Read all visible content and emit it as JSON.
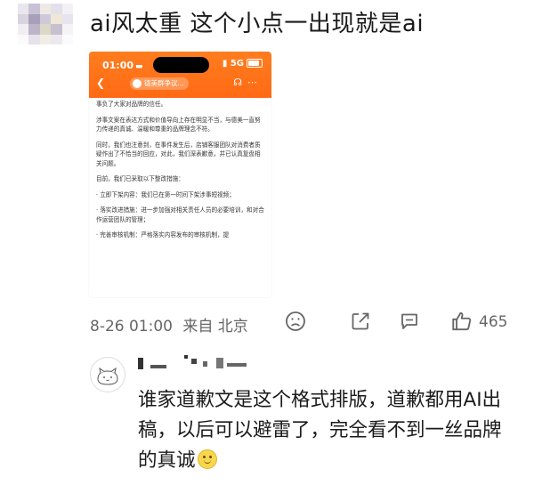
{
  "post": {
    "text": "ai风太重 这个小点一出现就是ai",
    "timestamp": "8-26 01:00",
    "source": "来自 北京",
    "likes": "465"
  },
  "screenshot": {
    "status_time": "01:00",
    "bed_icon": "bed-icon",
    "status_right": "5G",
    "nav_title": "德美群争议...",
    "paragraphs": [
      "事负了大家对品牌的信任。",
      "涉事文案在表达方式和价值导向上存在明显不当，与德美一直努力传递的真诚、温暖和尊重的品牌理念不符。",
      "同时，我们也注意到，在事件发生后，店铺客服团队对消费者质疑作出了不恰当的回应，对此，我们深表歉意，并已认真复盘相关问题。",
      "目前，我们已采取以下整改措施：",
      "· 立即下架内容：我们已在第一时间下架涉事短视频；",
      "· 落实改进措施：进一步加强对相关责任人员的必要培训，和对合作运营团队的管理；",
      "· 完善审核机制：严格落实内容发布的审核机制，提"
    ]
  },
  "actions": {
    "dislike_icon": "frown-icon",
    "share_icon": "share-icon",
    "comment_icon": "comment-icon",
    "like_icon": "thumbs-up-icon"
  },
  "comment": {
    "text": "谁家道歉文是这个格式排版，道歉都用AI出稿，以后可以避雷了，完全看不到一丝品牌的真诚",
    "emoji": "smile-emoji"
  },
  "colors": {
    "header_orange": "#ff7d1e",
    "text_dark": "#1a1a1a",
    "text_meta": "#666666"
  }
}
